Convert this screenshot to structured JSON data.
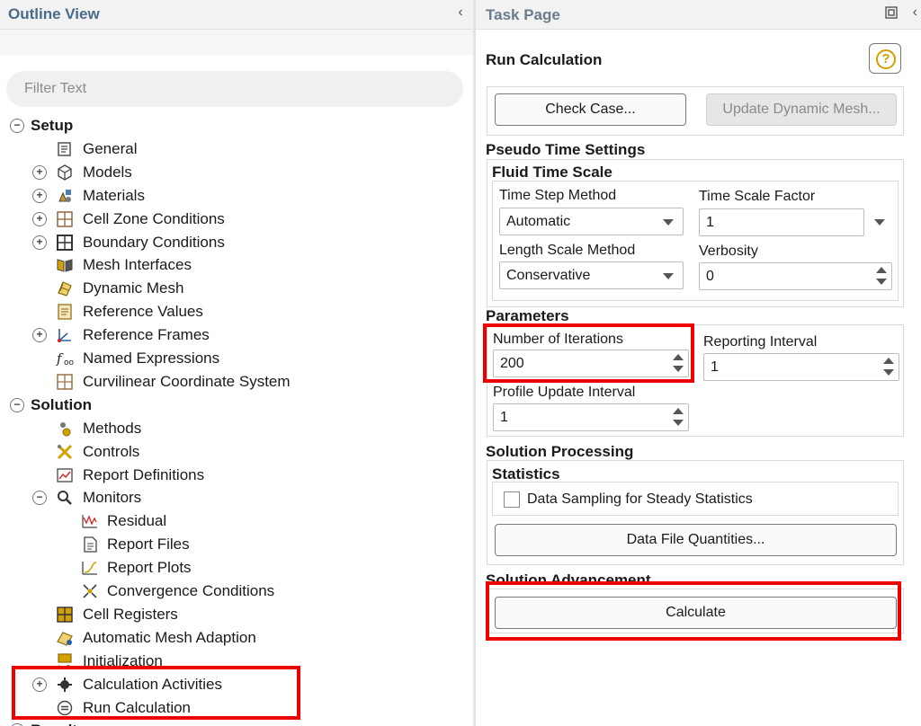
{
  "outline": {
    "title": "Outline View",
    "collapse_icon": "chevron-left-icon",
    "filter_placeholder": "Filter Text",
    "tree": [
      {
        "label": "Setup",
        "bold": true,
        "toggle": "−",
        "icon": ""
      },
      {
        "label": "General",
        "toggle": "",
        "icon": "general-icon"
      },
      {
        "label": "Models",
        "toggle": "+",
        "icon": "models-icon"
      },
      {
        "label": "Materials",
        "toggle": "+",
        "icon": "materials-icon"
      },
      {
        "label": "Cell Zone Conditions",
        "toggle": "+",
        "icon": "cell-zone-icon"
      },
      {
        "label": "Boundary Conditions",
        "toggle": "+",
        "icon": "boundary-icon"
      },
      {
        "label": "Mesh Interfaces",
        "toggle": "",
        "icon": "mesh-interfaces-icon"
      },
      {
        "label": "Dynamic Mesh",
        "toggle": "",
        "icon": "dynamic-mesh-icon"
      },
      {
        "label": "Reference Values",
        "toggle": "",
        "icon": "reference-values-icon"
      },
      {
        "label": "Reference Frames",
        "toggle": "+",
        "icon": "reference-frames-icon"
      },
      {
        "label": "Named Expressions",
        "toggle": "",
        "icon": "named-expressions-icon"
      },
      {
        "label": "Curvilinear Coordinate System",
        "toggle": "",
        "icon": "curvilinear-icon"
      },
      {
        "label": "Solution",
        "bold": true,
        "toggle": "−",
        "icon": ""
      },
      {
        "label": "Methods",
        "toggle": "",
        "icon": "methods-icon"
      },
      {
        "label": "Controls",
        "toggle": "",
        "icon": "controls-icon"
      },
      {
        "label": "Report Definitions",
        "toggle": "",
        "icon": "report-definitions-icon"
      },
      {
        "label": "Monitors",
        "toggle": "−",
        "icon": "monitors-icon"
      },
      {
        "label": "Residual",
        "toggle": "",
        "icon": "residual-icon",
        "deep": true
      },
      {
        "label": "Report Files",
        "toggle": "",
        "icon": "report-files-icon",
        "deep": true
      },
      {
        "label": "Report Plots",
        "toggle": "",
        "icon": "report-plots-icon",
        "deep": true
      },
      {
        "label": "Convergence Conditions",
        "toggle": "",
        "icon": "convergence-icon",
        "deep": true
      },
      {
        "label": "Cell Registers",
        "toggle": "",
        "icon": "cell-registers-icon"
      },
      {
        "label": "Automatic Mesh Adaption",
        "toggle": "",
        "icon": "mesh-adaption-icon"
      },
      {
        "label": "Initialization",
        "toggle": "",
        "icon": "initialization-icon"
      },
      {
        "label": "Calculation Activities",
        "toggle": "+",
        "icon": "calculation-activities-icon"
      },
      {
        "label": "Run Calculation",
        "toggle": "",
        "icon": "run-calculation-icon"
      },
      {
        "label": "Results",
        "bold": true,
        "toggle": "+",
        "icon": ""
      }
    ]
  },
  "task": {
    "title": "Task Page",
    "popout_icon": "popout-icon",
    "collapse_icon": "chevron-left-icon",
    "heading": "Run Calculation",
    "help_icon": "help-icon",
    "check_case_label": "Check Case...",
    "update_mesh_label": "Update Dynamic Mesh...",
    "pseudo": {
      "title": "Pseudo Time Settings",
      "fluid_title": "Fluid Time Scale",
      "time_step_method_label": "Time Step Method",
      "time_step_method_value": "Automatic",
      "time_scale_factor_label": "Time Scale Factor",
      "time_scale_factor_value": "1",
      "length_scale_method_label": "Length Scale Method",
      "length_scale_method_value": "Conservative",
      "verbosity_label": "Verbosity",
      "verbosity_value": "0"
    },
    "parameters": {
      "title": "Parameters",
      "iterations_label": "Number of Iterations",
      "iterations_value": "200",
      "reporting_label": "Reporting Interval",
      "reporting_value": "1",
      "profile_label": "Profile Update Interval",
      "profile_value": "1"
    },
    "processing": {
      "title": "Solution Processing",
      "stats_title": "Statistics",
      "sampling_label": "Data Sampling for Steady Statistics",
      "sampling_checked": false,
      "data_file_label": "Data File Quantities..."
    },
    "advancement": {
      "title": "Solution Advancement",
      "calculate_label": "Calculate"
    }
  },
  "highlight_color": "#ee0000"
}
